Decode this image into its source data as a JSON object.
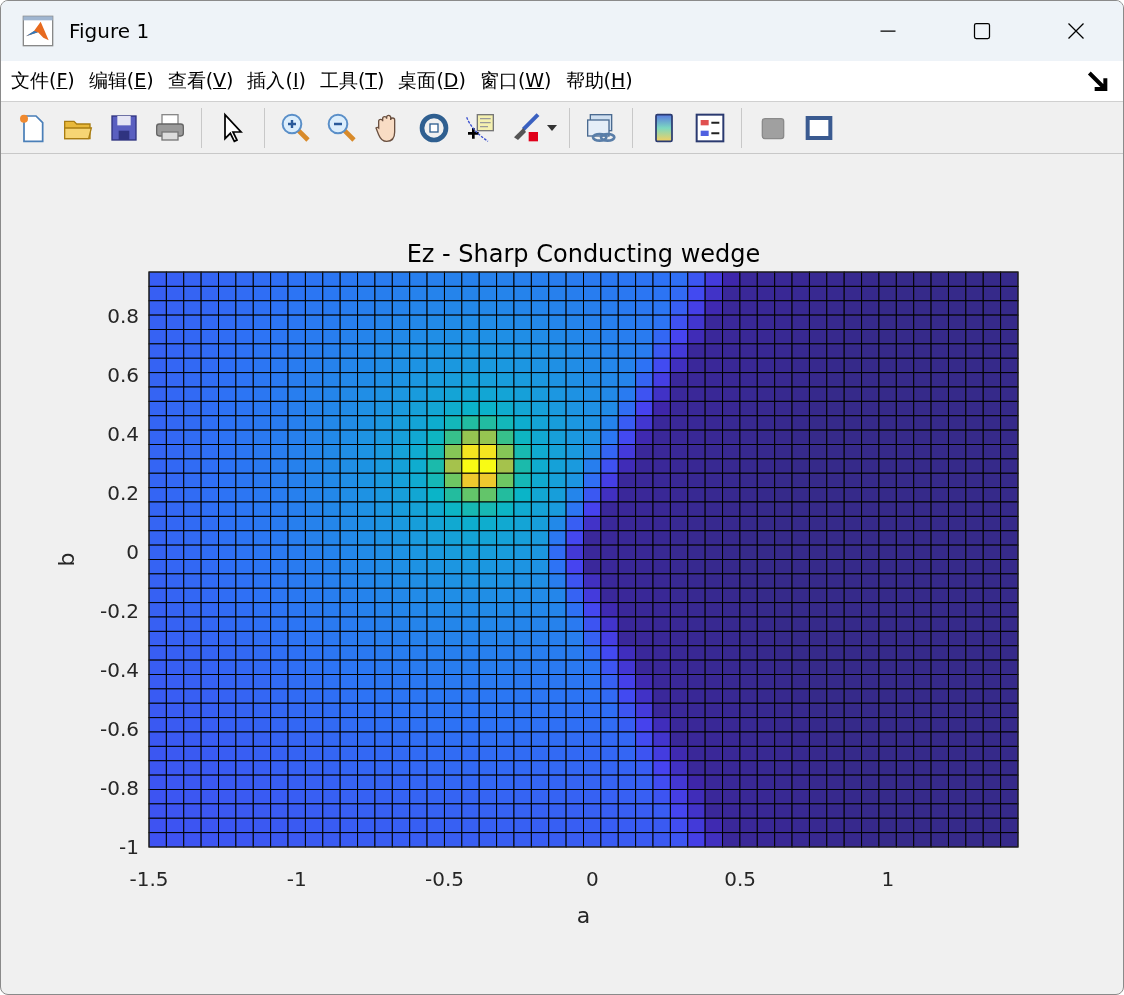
{
  "window": {
    "title": "Figure 1"
  },
  "menu": [
    "文件(F)",
    "编辑(E)",
    "查看(V)",
    "插入(I)",
    "工具(T)",
    "桌面(D)",
    "窗口(W)",
    "帮助(H)"
  ],
  "plot": {
    "title": "Ez - Sharp Conducting wedge",
    "xlabel": "a",
    "ylabel": "b",
    "xticks": [
      "-1.5",
      "-1",
      "-0.5",
      "0",
      "0.5",
      "1"
    ],
    "yticks": [
      "0.8",
      "0.6",
      "0.4",
      "0.2",
      "0",
      "-0.2",
      "-0.4",
      "-0.6",
      "-0.8",
      "-1"
    ]
  }
}
